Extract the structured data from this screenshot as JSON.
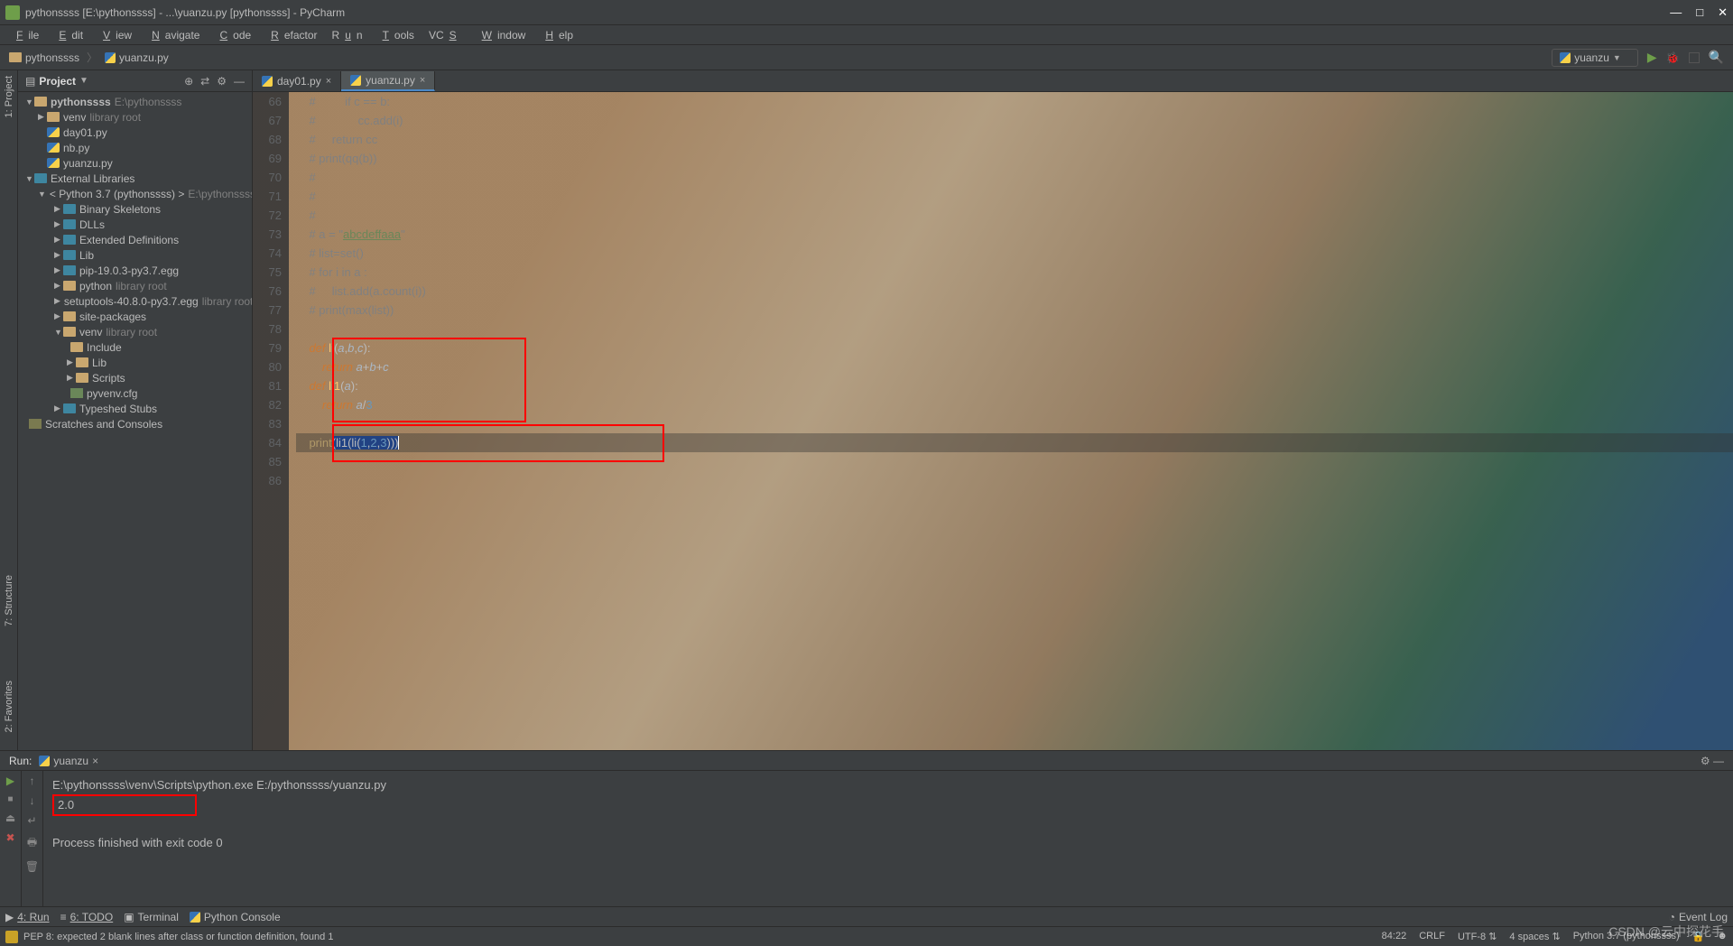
{
  "window": {
    "title": "pythonssss [E:\\pythonssss] - ...\\yuanzu.py [pythonssss] - PyCharm"
  },
  "menu": [
    "File",
    "Edit",
    "View",
    "Navigate",
    "Code",
    "Refactor",
    "Run",
    "Tools",
    "VCS",
    "Window",
    "Help"
  ],
  "breadcrumb": {
    "root": "pythonssss",
    "file": "yuanzu.py"
  },
  "runconfig": {
    "name": "yuanzu"
  },
  "project": {
    "label": "Project",
    "root": {
      "name": "pythonssss",
      "path": "E:\\pythonssss"
    },
    "venv": {
      "name": "venv",
      "suffix": "library root"
    },
    "files": [
      "day01.py",
      "nb.py",
      "yuanzu.py"
    ],
    "external": "External Libraries",
    "py37": "< Python 3.7 (pythonssss) >",
    "py37path": "E:\\pythonssss\\venv",
    "libs": [
      "Binary Skeletons",
      "DLLs",
      "Extended Definitions",
      "Lib",
      "pip-19.0.3-py3.7.egg"
    ],
    "pythonlr": {
      "name": "python",
      "suffix": "library root"
    },
    "setuptools": {
      "name": "setuptools-40.8.0-py3.7.egg",
      "suffix": "library root"
    },
    "sitepkg": "site-packages",
    "venv2": {
      "name": "venv",
      "suffix": "library root"
    },
    "venv2items": [
      "Include",
      "Lib",
      "Scripts"
    ],
    "pyvenv": "pyvenv.cfg",
    "typeshed": "Typeshed Stubs",
    "scratches": "Scratches and Consoles"
  },
  "tabs": [
    {
      "name": "day01.py",
      "active": false
    },
    {
      "name": "yuanzu.py",
      "active": true
    }
  ],
  "code": {
    "start": 66,
    "lines": [
      "    #         if c == b:",
      "    #             cc.add(i)",
      "    #     return cc",
      "    # print(qq(b))",
      "    #",
      "    #",
      "    #",
      "    # a = \"abcdeffaaa\"",
      "    # list=set()",
      "    # for i in a :",
      "    #     list.add(a.count(i))",
      "    # print(max(list))",
      "",
      "    def li(a,b,c):",
      "        return a+b+c",
      "    def li1(a):",
      "        return a/3",
      "",
      "    print(li1(li(1,2,3)))",
      "",
      ""
    ]
  },
  "run": {
    "label": "Run:",
    "tab": "yuanzu",
    "cmd": "E:\\pythonssss\\venv\\Scripts\\python.exe E:/pythonssss/yuanzu.py",
    "out": "2.0",
    "exit": "Process finished with exit code 0"
  },
  "bottombar": {
    "run": "4: Run",
    "todo": "6: TODO",
    "terminal": "Terminal",
    "pyconsole": "Python Console",
    "eventlog": "Event Log"
  },
  "status": {
    "msg": "PEP 8: expected 2 blank lines after class or function definition, found 1",
    "pos": "84:22",
    "crlf": "CRLF",
    "enc": "UTF-8",
    "indent": "4 spaces",
    "interp": "Python 3.7 (pythonssss)"
  },
  "sidetabs": {
    "project": "1: Project",
    "structure": "7: Structure",
    "favorites": "2: Favorites"
  },
  "watermark": "CSDN @云中探花手"
}
